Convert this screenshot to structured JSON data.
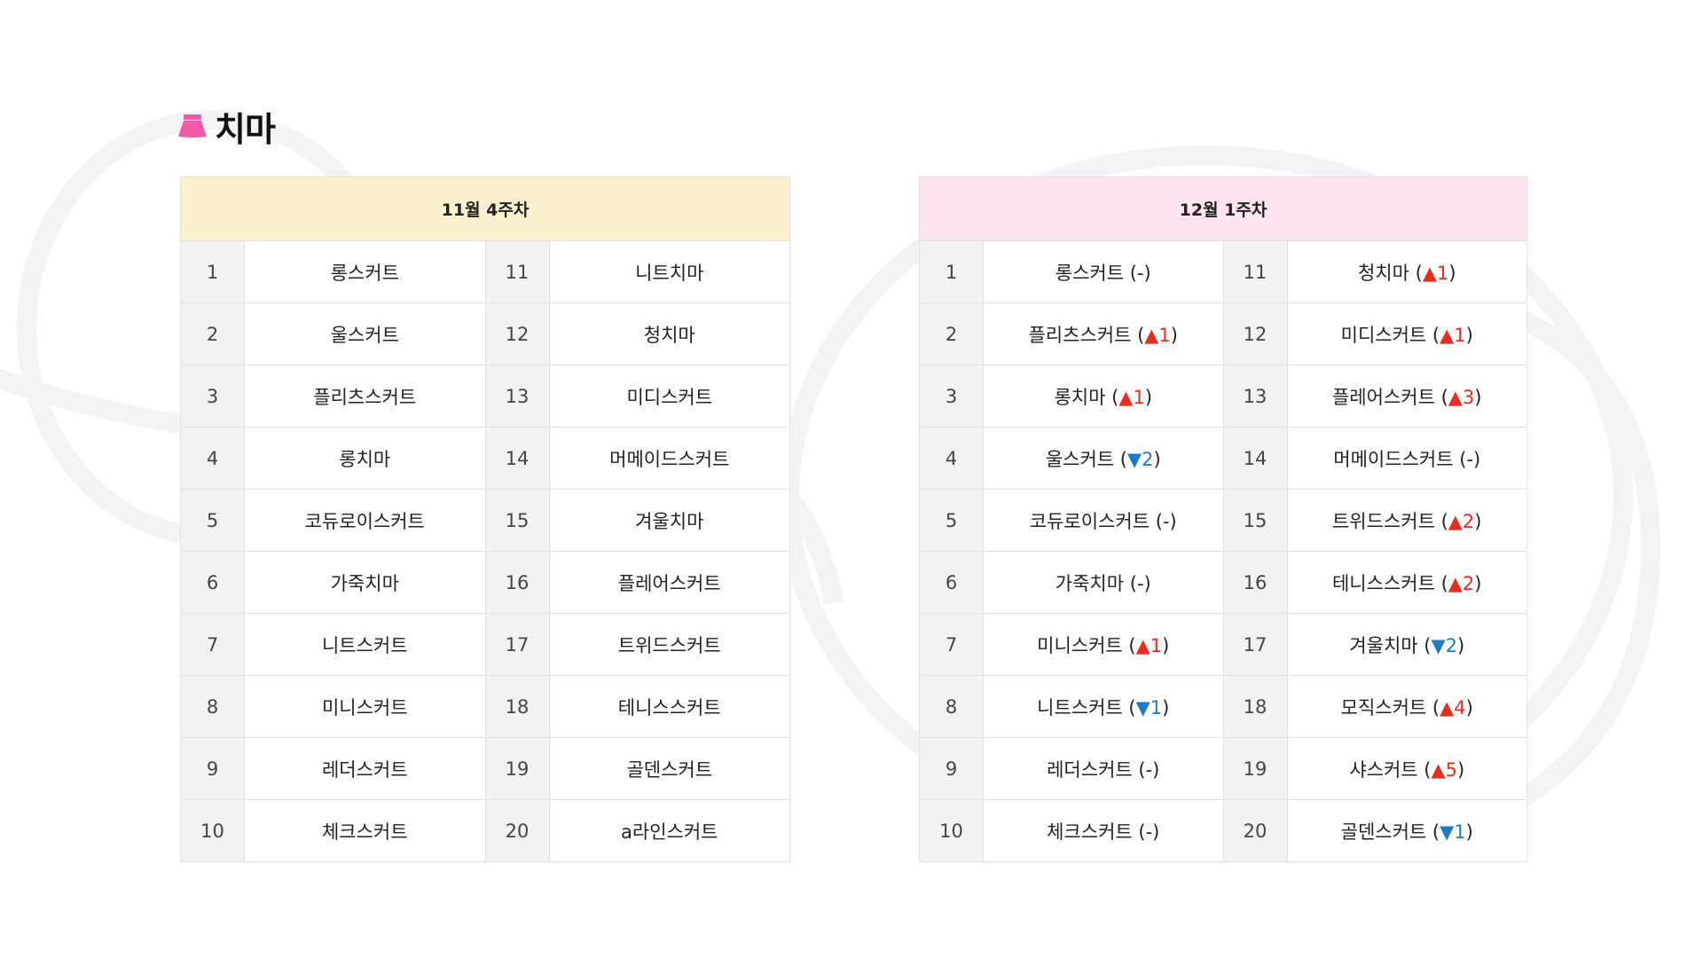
{
  "title": {
    "icon": "skirt-icon",
    "text": "치마",
    "icon_color": "#f25aa8"
  },
  "colors": {
    "left_header_bg": "#fdf0cf",
    "right_header_bg": "#ffe3ef",
    "up": "#e62e20",
    "down": "#1f7bc1"
  },
  "tables": [
    {
      "header": "11월 4주차",
      "rows": [
        {
          "l_rank": "1",
          "l_name": "롱스커트",
          "r_rank": "11",
          "r_name": "니트치마"
        },
        {
          "l_rank": "2",
          "l_name": "울스커트",
          "r_rank": "12",
          "r_name": "청치마"
        },
        {
          "l_rank": "3",
          "l_name": "플리츠스커트",
          "r_rank": "13",
          "r_name": "미디스커트"
        },
        {
          "l_rank": "4",
          "l_name": "롱치마",
          "r_rank": "14",
          "r_name": "머메이드스커트"
        },
        {
          "l_rank": "5",
          "l_name": "코듀로이스커트",
          "r_rank": "15",
          "r_name": "겨울치마"
        },
        {
          "l_rank": "6",
          "l_name": "가죽치마",
          "r_rank": "16",
          "r_name": "플레어스커트"
        },
        {
          "l_rank": "7",
          "l_name": "니트스커트",
          "r_rank": "17",
          "r_name": "트위드스커트"
        },
        {
          "l_rank": "8",
          "l_name": "미니스커트",
          "r_rank": "18",
          "r_name": "테니스스커트"
        },
        {
          "l_rank": "9",
          "l_name": "레더스커트",
          "r_rank": "19",
          "r_name": "골덴스커트"
        },
        {
          "l_rank": "10",
          "l_name": "체크스커트",
          "r_rank": "20",
          "r_name": "a라인스커트"
        }
      ]
    },
    {
      "header": "12월 1주차",
      "rows": [
        {
          "l_rank": "1",
          "l_name": "롱스커트",
          "l_change": "-",
          "r_rank": "11",
          "r_name": "청치마",
          "r_change": "▲1"
        },
        {
          "l_rank": "2",
          "l_name": "플리츠스커트",
          "l_change": "▲1",
          "r_rank": "12",
          "r_name": "미디스커트",
          "r_change": "▲1"
        },
        {
          "l_rank": "3",
          "l_name": "롱치마",
          "l_change": "▲1",
          "r_rank": "13",
          "r_name": "플레어스커트",
          "r_change": "▲3"
        },
        {
          "l_rank": "4",
          "l_name": "울스커트",
          "l_change": "▼2",
          "r_rank": "14",
          "r_name": "머메이드스커트",
          "r_change": "-"
        },
        {
          "l_rank": "5",
          "l_name": "코듀로이스커트",
          "l_change": "-",
          "r_rank": "15",
          "r_name": "트위드스커트",
          "r_change": "▲2"
        },
        {
          "l_rank": "6",
          "l_name": "가죽치마",
          "l_change": "-",
          "r_rank": "16",
          "r_name": "테니스스커트",
          "r_change": "▲2"
        },
        {
          "l_rank": "7",
          "l_name": "미니스커트",
          "l_change": "▲1",
          "r_rank": "17",
          "r_name": "겨울치마",
          "r_change": "▼2"
        },
        {
          "l_rank": "8",
          "l_name": "니트스커트",
          "l_change": "▼1",
          "r_rank": "18",
          "r_name": "모직스커트",
          "r_change": "▲4"
        },
        {
          "l_rank": "9",
          "l_name": "레더스커트",
          "l_change": "-",
          "r_rank": "19",
          "r_name": "샤스커트",
          "r_change": "▲5"
        },
        {
          "l_rank": "10",
          "l_name": "체크스커트",
          "l_change": "-",
          "r_rank": "20",
          "r_name": "골덴스커트",
          "r_change": "▼1"
        }
      ]
    }
  ]
}
